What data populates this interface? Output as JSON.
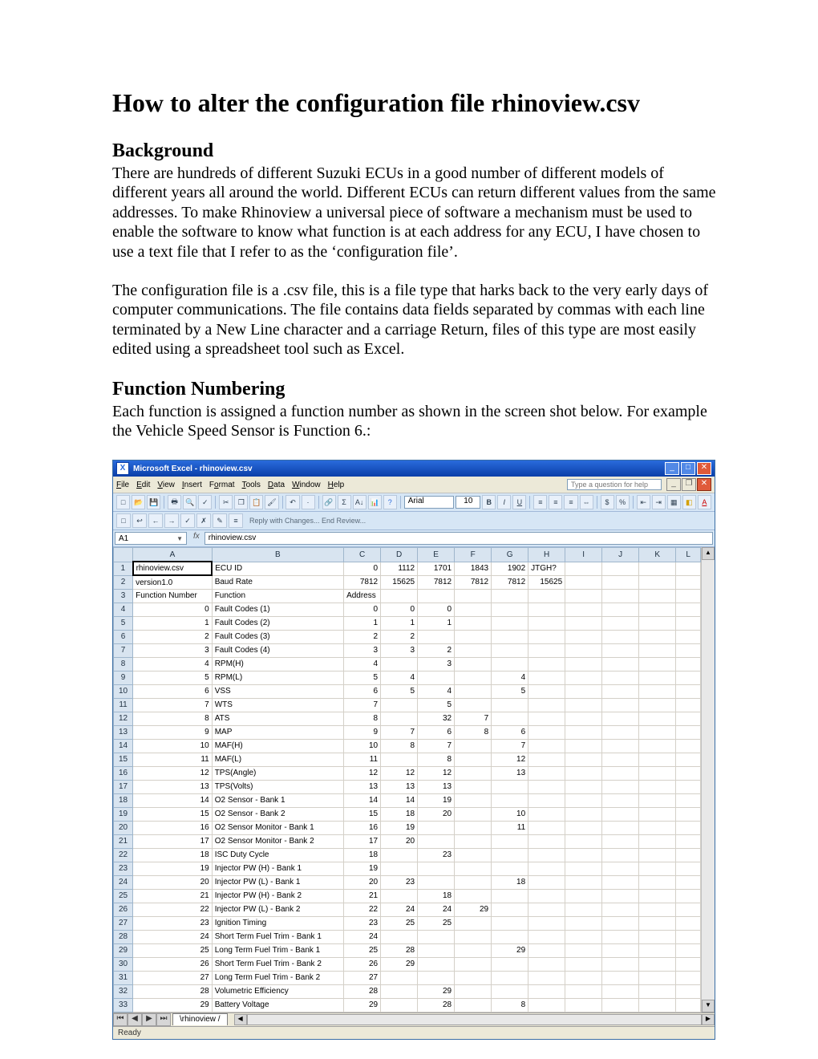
{
  "doc": {
    "title": "How to alter the configuration file rhinoview.csv",
    "h_background": "Background",
    "p_background": "There are hundreds of different Suzuki ECUs in a good number of different models of different years all around the world. Different ECUs can return different values from the same addresses. To make Rhinoview a universal piece of software a mechanism must be used to enable the software to know what function is at each address for any ECU, I have chosen to use a text file that I refer to as the ‘configuration file’.",
    "p_cfg": "The configuration file is a .csv file, this is a file type that harks back to the very early days of computer communications. The file contains data fields separated by commas with each line terminated by  a New Line character and a carriage Return, files of this type are most easily edited using a spreadsheet tool such as Excel.",
    "h_func": "Function Numbering",
    "p_func": "Each function is assigned a function number as shown in the screen shot below. For example the Vehicle Speed Sensor is Function 6.:"
  },
  "excel": {
    "title": "Microsoft Excel - rhinoview.csv",
    "menus": [
      "File",
      "Edit",
      "View",
      "Insert",
      "Format",
      "Tools",
      "Data",
      "Window",
      "Help"
    ],
    "help_placeholder": "Type a question for help",
    "font_name": "Arial",
    "font_size": "10",
    "review_label": "Reply with Changes...  End Review...",
    "namebox": "A1",
    "formula": "rhinoview.csv",
    "cols": [
      "A",
      "B",
      "C",
      "D",
      "E",
      "F",
      "G",
      "H",
      "I",
      "J",
      "K",
      "L"
    ],
    "rows": [
      {
        "n": "1",
        "A": "rhinoview.csv",
        "B": "ECU ID",
        "C": "0",
        "D": "1112",
        "E": "1701",
        "F": "1843",
        "G": "1902",
        "H": "JTGH?"
      },
      {
        "n": "2",
        "A": "version1.0",
        "B": "Baud Rate",
        "C": "7812",
        "D": "15625",
        "E": "7812",
        "F": "7812",
        "G": "7812",
        "H": "15625"
      },
      {
        "n": "3",
        "A": "Function Number",
        "B": "Function",
        "Ctxt": "Address"
      },
      {
        "n": "4",
        "A": "0",
        "B": "Fault Codes (1)",
        "C": "0",
        "D": "0",
        "E": "0"
      },
      {
        "n": "5",
        "A": "1",
        "B": "Fault Codes (2)",
        "C": "1",
        "D": "1",
        "E": "1"
      },
      {
        "n": "6",
        "A": "2",
        "B": "Fault Codes (3)",
        "C": "2",
        "D": "2"
      },
      {
        "n": "7",
        "A": "3",
        "B": "Fault Codes (4)",
        "C": "3",
        "D": "3",
        "E": "2"
      },
      {
        "n": "8",
        "A": "4",
        "B": "RPM(H)",
        "C": "4",
        "E": "3"
      },
      {
        "n": "9",
        "A": "5",
        "B": "RPM(L)",
        "C": "5",
        "D": "4",
        "G": "4"
      },
      {
        "n": "10",
        "A": "6",
        "B": "VSS",
        "C": "6",
        "D": "5",
        "E": "4",
        "G": "5"
      },
      {
        "n": "11",
        "A": "7",
        "B": "WTS",
        "C": "7",
        "E": "5"
      },
      {
        "n": "12",
        "A": "8",
        "B": "ATS",
        "C": "8",
        "E": "32",
        "F": "7"
      },
      {
        "n": "13",
        "A": "9",
        "B": "MAP",
        "C": "9",
        "D": "7",
        "E": "6",
        "F": "8",
        "G": "6"
      },
      {
        "n": "14",
        "A": "10",
        "B": "MAF(H)",
        "C": "10",
        "D": "8",
        "E": "7",
        "G": "7"
      },
      {
        "n": "15",
        "A": "11",
        "B": "MAF(L)",
        "C": "11",
        "E": "8",
        "G": "12"
      },
      {
        "n": "16",
        "A": "12",
        "B": "TPS(Angle)",
        "C": "12",
        "D": "12",
        "E": "12",
        "G": "13"
      },
      {
        "n": "17",
        "A": "13",
        "B": "TPS(Volts)",
        "C": "13",
        "D": "13",
        "E": "13"
      },
      {
        "n": "18",
        "A": "14",
        "B": "O2 Sensor - Bank 1",
        "C": "14",
        "D": "14",
        "E": "19"
      },
      {
        "n": "19",
        "A": "15",
        "B": "O2 Sensor - Bank 2",
        "C": "15",
        "D": "18",
        "E": "20",
        "G": "10"
      },
      {
        "n": "20",
        "A": "16",
        "B": "O2 Sensor Monitor - Bank 1",
        "C": "16",
        "D": "19",
        "G": "11"
      },
      {
        "n": "21",
        "A": "17",
        "B": "O2 Sensor Monitor - Bank 2",
        "C": "17",
        "D": "20"
      },
      {
        "n": "22",
        "A": "18",
        "B": "ISC Duty Cycle",
        "C": "18",
        "E": "23"
      },
      {
        "n": "23",
        "A": "19",
        "B": "Injector PW (H) - Bank 1",
        "C": "19"
      },
      {
        "n": "24",
        "A": "20",
        "B": "Injector PW (L) - Bank 1",
        "C": "20",
        "D": "23",
        "G": "18"
      },
      {
        "n": "25",
        "A": "21",
        "B": "Injector PW (H) - Bank 2",
        "C": "21",
        "E": "18"
      },
      {
        "n": "26",
        "A": "22",
        "B": "Injector PW (L) - Bank 2",
        "C": "22",
        "D": "24",
        "E": "24",
        "F": "29"
      },
      {
        "n": "27",
        "A": "23",
        "B": "Ignition Timing",
        "C": "23",
        "D": "25",
        "E": "25"
      },
      {
        "n": "28",
        "A": "24",
        "B": "Short Term Fuel Trim - Bank 1",
        "C": "24"
      },
      {
        "n": "29",
        "A": "25",
        "B": "Long Term Fuel Trim - Bank 1",
        "C": "25",
        "D": "28",
        "G": "29"
      },
      {
        "n": "30",
        "A": "26",
        "B": "Short Term Fuel Trim - Bank 2",
        "C": "26",
        "D": "29"
      },
      {
        "n": "31",
        "A": "27",
        "B": "Long Term Fuel Trim - Bank 2",
        "C": "27"
      },
      {
        "n": "32",
        "A": "28",
        "B": "Volumetric Efficiency",
        "C": "28",
        "E": "29"
      },
      {
        "n": "33",
        "A": "29",
        "B": "Battery Voltage",
        "C": "29",
        "E": "28",
        "G": "8"
      }
    ],
    "sheet_tab": "rhinoview",
    "status": "Ready"
  }
}
